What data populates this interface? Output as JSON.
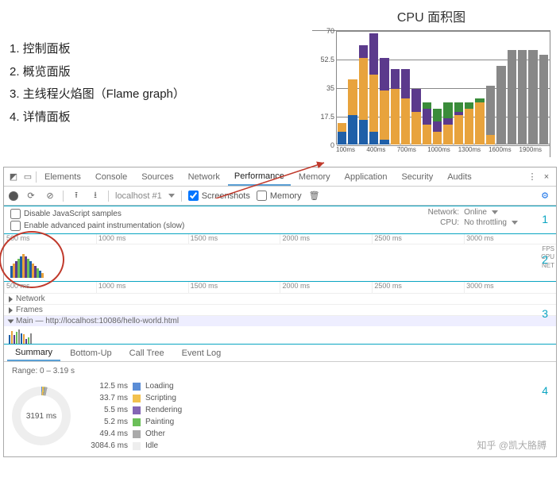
{
  "top_chart_title": "CPU 面积图",
  "notes": {
    "items": [
      "1.  控制面板",
      "2.  概览面版",
      "3.  主线程火焰图（Flame graph）",
      "4.  详情面板"
    ]
  },
  "chart_data": {
    "type": "bar",
    "title": "CPU 面积图",
    "xlabel": "",
    "ylabel": "",
    "ylim": [
      0,
      70
    ],
    "yticks": [
      0,
      17.5,
      35,
      52.5,
      70
    ],
    "categories": [
      "100ms",
      "200ms",
      "300ms",
      "400ms",
      "500ms",
      "600ms",
      "700ms",
      "800ms",
      "900ms",
      "1000ms",
      "1100ms",
      "1200ms",
      "1300ms",
      "1400ms",
      "1500ms",
      "1600ms",
      "1700ms",
      "1800ms",
      "1900ms",
      "2000ms"
    ],
    "xticks_shown": [
      "100ms",
      "400ms",
      "700ms",
      "1000ms",
      "1300ms",
      "1600ms",
      "1900ms"
    ],
    "series": [
      {
        "name": "Loading",
        "color": "#1f5fa8",
        "values": [
          8,
          18,
          15,
          8,
          3,
          0,
          0,
          0,
          0,
          0,
          0,
          0,
          0,
          0,
          0,
          0,
          0,
          0,
          0,
          0
        ]
      },
      {
        "name": "Scripting",
        "color": "#e8a33d",
        "values": [
          5,
          22,
          38,
          35,
          30,
          34,
          28,
          20,
          12,
          8,
          12,
          18,
          22,
          26,
          6,
          0,
          0,
          0,
          0,
          0
        ]
      },
      {
        "name": "Rendering",
        "color": "#5b3a8c",
        "values": [
          0,
          0,
          8,
          25,
          20,
          12,
          18,
          14,
          10,
          6,
          4,
          2,
          0,
          0,
          0,
          0,
          0,
          0,
          0,
          0
        ]
      },
      {
        "name": "Painting",
        "color": "#3a8c3a",
        "values": [
          0,
          0,
          0,
          0,
          0,
          0,
          0,
          0,
          4,
          8,
          10,
          6,
          4,
          2,
          0,
          0,
          0,
          0,
          0,
          0
        ]
      },
      {
        "name": "Other",
        "color": "#888",
        "values": [
          0,
          0,
          0,
          0,
          0,
          0,
          0,
          0,
          0,
          0,
          0,
          0,
          0,
          0,
          30,
          48,
          58,
          58,
          58,
          55
        ]
      }
    ]
  },
  "devtools": {
    "tabs": [
      "Elements",
      "Console",
      "Sources",
      "Network",
      "Performance",
      "Memory",
      "Application",
      "Security",
      "Audits"
    ],
    "active_tab": "Performance",
    "record_tooltip": "Record",
    "dropdown": "localhost #1",
    "checkboxes": {
      "screenshots": "Screenshots",
      "memory": "Memory"
    },
    "settings": {
      "disable_js": "Disable JavaScript samples",
      "paint_instr": "Enable advanced paint instrumentation (slow)",
      "network_label": "Network:",
      "network_value": "Online",
      "cpu_label": "CPU:",
      "cpu_value": "No throttling"
    },
    "overview_ticks": [
      "500 ms",
      "1000 ms",
      "1500 ms",
      "2000 ms",
      "2500 ms",
      "3000 ms"
    ],
    "overview_labels": [
      "FPS",
      "CPU",
      "NET"
    ],
    "flame": {
      "ticks": [
        "500 ms",
        "1000 ms",
        "1500 ms",
        "2000 ms",
        "2500 ms",
        "3000 ms"
      ],
      "rows": [
        "Network",
        "Frames"
      ],
      "main": "Main — http://localhost:10086/hello-world.html"
    },
    "details": {
      "tabs": [
        "Summary",
        "Bottom-Up",
        "Call Tree",
        "Event Log"
      ],
      "active": "Summary",
      "range": "Range: 0 – 3.19 s",
      "total": "3191 ms",
      "legend": [
        {
          "t": "12.5 ms",
          "c": "#5b8dd6",
          "l": "Loading"
        },
        {
          "t": "33.7 ms",
          "c": "#f2c14e",
          "l": "Scripting"
        },
        {
          "t": "5.5 ms",
          "c": "#8466b5",
          "l": "Rendering"
        },
        {
          "t": "5.2 ms",
          "c": "#6bbf59",
          "l": "Painting"
        },
        {
          "t": "49.4 ms",
          "c": "#aaa",
          "l": "Other"
        },
        {
          "t": "3084.6 ms",
          "c": "#eee",
          "l": "Idle"
        }
      ]
    },
    "panel_nums": {
      "p1": "1",
      "p2": "2",
      "p3": "3",
      "p4": "4"
    }
  },
  "watermark": "知乎 @凯大胳膊"
}
